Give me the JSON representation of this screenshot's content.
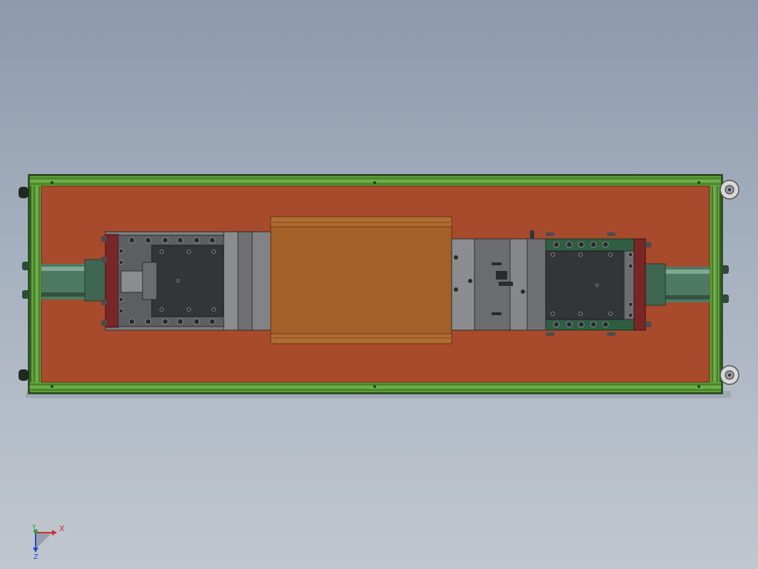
{
  "app": {
    "view": "cad-3d-viewport",
    "projection": "top"
  },
  "model": {
    "description_free": true,
    "colors": {
      "frame_green": "#5fa23a",
      "frame_dark": "#2f5a20",
      "base_plate": "#a84a2c",
      "center_block": "#a3612a",
      "center_block_edge": "#7a3e15",
      "steel": "#7b7d80",
      "steel_dark": "#4a4c4f",
      "steel_darker": "#333538",
      "cylinder": "#4e7a63",
      "red_plate": "#7a2626",
      "green_plate": "#2f5e42"
    }
  },
  "triad": {
    "x_label": "X",
    "y_label": "Y",
    "z_label": "Z",
    "x_color": "#d62a2a",
    "y_color": "#2ca53a",
    "z_color": "#2a4bd6"
  }
}
